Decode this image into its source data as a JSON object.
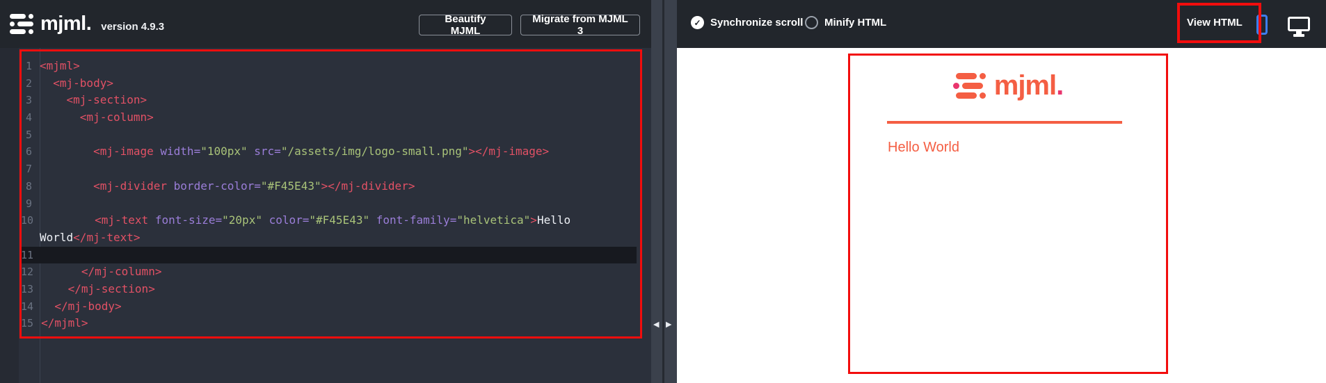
{
  "header": {
    "brand_name": "mjml",
    "brand_period": ".",
    "version": "version 4.9.3",
    "beautify_label": "Beautify MJML",
    "migrate_label": "Migrate from MJML 3",
    "sync_label": "Synchronize scroll",
    "minify_label": "Minify HTML",
    "view_html_label": "View HTML"
  },
  "icons": {
    "sync_check_glyph": "✓",
    "collapse_left_glyph": "◀",
    "collapse_right_glyph": "▶"
  },
  "colors": {
    "mjml_coral": "#F45E43",
    "mjml_pink": "#E9356D",
    "annotation_red": "#F20D0D",
    "phone_active_blue": "#3D7EF0"
  },
  "editor": {
    "lines": [
      {
        "n": "1",
        "active": false,
        "tokens": [
          {
            "c": "tag",
            "v": "<mjml>"
          }
        ]
      },
      {
        "n": "2",
        "active": false,
        "tokens": [
          {
            "c": "tag",
            "v": "  <mj-body>"
          }
        ]
      },
      {
        "n": "3",
        "active": false,
        "tokens": [
          {
            "c": "tag",
            "v": "    <mj-section>"
          }
        ]
      },
      {
        "n": "4",
        "active": false,
        "tokens": [
          {
            "c": "tag",
            "v": "      <mj-column>"
          }
        ]
      },
      {
        "n": "5",
        "active": false,
        "tokens": []
      },
      {
        "n": "6",
        "active": false,
        "tokens": [
          {
            "c": "tag",
            "v": "        <mj-image"
          },
          {
            "c": "attr",
            "v": " width="
          },
          {
            "c": "str",
            "v": "\"100px\""
          },
          {
            "c": "attr",
            "v": " src="
          },
          {
            "c": "str",
            "v": "\"/assets/img/logo-small.png\""
          },
          {
            "c": "tag",
            "v": "></mj-image>"
          }
        ]
      },
      {
        "n": "7",
        "active": false,
        "tokens": []
      },
      {
        "n": "8",
        "active": false,
        "tokens": [
          {
            "c": "tag",
            "v": "        <mj-divider"
          },
          {
            "c": "attr",
            "v": " border-color="
          },
          {
            "c": "str",
            "v": "\"#F45E43\""
          },
          {
            "c": "tag",
            "v": "></mj-divider>"
          }
        ]
      },
      {
        "n": "9",
        "active": false,
        "tokens": []
      },
      {
        "n": "10",
        "active": false,
        "tokens": [
          {
            "c": "tag",
            "v": "        <mj-text"
          },
          {
            "c": "attr",
            "v": " font-size="
          },
          {
            "c": "str",
            "v": "\"20px\""
          },
          {
            "c": "attr",
            "v": " color="
          },
          {
            "c": "str",
            "v": "\"#F45E43\""
          },
          {
            "c": "attr",
            "v": " font-family="
          },
          {
            "c": "str",
            "v": "\"helvetica\""
          },
          {
            "c": "tag",
            "v": ">"
          },
          {
            "c": "txt",
            "v": "Hello"
          }
        ]
      },
      {
        "n": "",
        "active": false,
        "tokens": [
          {
            "c": "txt",
            "v": "World"
          },
          {
            "c": "tag",
            "v": "</mj-text>"
          }
        ]
      },
      {
        "n": "11",
        "active": true,
        "tokens": []
      },
      {
        "n": "12",
        "active": false,
        "tokens": [
          {
            "c": "tag",
            "v": "      </mj-column>"
          }
        ]
      },
      {
        "n": "13",
        "active": false,
        "tokens": [
          {
            "c": "tag",
            "v": "    </mj-section>"
          }
        ]
      },
      {
        "n": "14",
        "active": false,
        "tokens": [
          {
            "c": "tag",
            "v": "  </mj-body>"
          }
        ]
      },
      {
        "n": "15",
        "active": false,
        "tokens": [
          {
            "c": "tag",
            "v": "</mjml>"
          }
        ]
      }
    ]
  },
  "preview": {
    "logo_text": "mjml",
    "logo_period": ".",
    "hello_text": "Hello World"
  }
}
